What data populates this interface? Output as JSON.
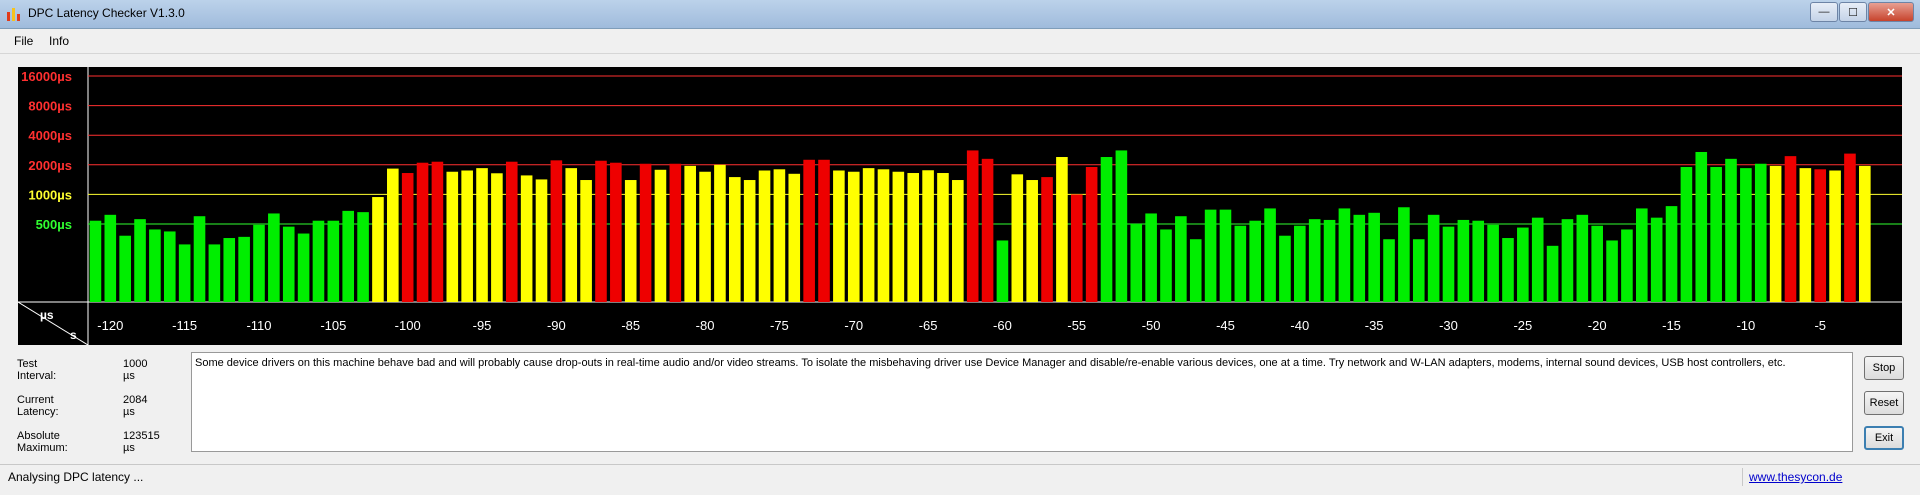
{
  "window": {
    "title": "DPC Latency Checker V1.3.0",
    "controls": [
      "minimize",
      "maximize",
      "close"
    ]
  },
  "menu": {
    "items": [
      {
        "label": "File"
      },
      {
        "label": "Info"
      }
    ]
  },
  "chart_data": {
    "type": "bar",
    "title": "",
    "y_scale": "log",
    "y_units_label": "µs",
    "x_units_label": "s",
    "y_gridlines": [
      {
        "label": "16000µs",
        "value": 16000,
        "color": "#ff3030"
      },
      {
        "label": "8000µs",
        "value": 8000,
        "color": "#ff3030"
      },
      {
        "label": "4000µs",
        "value": 4000,
        "color": "#ff3030"
      },
      {
        "label": "2000µs",
        "value": 2000,
        "color": "#ff3030"
      },
      {
        "label": "1000µs",
        "value": 1000,
        "color": "#ffff30"
      },
      {
        "label": "500µs",
        "value": 500,
        "color": "#30ff30"
      }
    ],
    "x_ticks": [
      -120,
      -115,
      -110,
      -105,
      -100,
      -95,
      -90,
      -85,
      -80,
      -75,
      -70,
      -65,
      -60,
      -55,
      -50,
      -45,
      -40,
      -35,
      -30,
      -25,
      -20,
      -15,
      -10,
      -5
    ],
    "x_range": [
      -121,
      1
    ],
    "colors": {
      "green": "#00ee00",
      "yellow": "#ffff00",
      "red": "#ee0000"
    },
    "series": [
      {
        "x_start": -121,
        "x_step": 1,
        "levels": "GGGGGGGGGGGGGGGGGGGYYRRRYYYYRYYRYYRRYRYRYYYYYYYYRRYYYYYYYYYRRGYYRYRRGGGGGGGGGGGGGGGGGGGGGGGGGGGGGGGGGGGGGGGGGGGGGYRYRYRYRYYRY",
        "values": [
          540,
          620,
          380,
          560,
          440,
          420,
          310,
          600,
          310,
          360,
          370,
          490,
          640,
          470,
          400,
          540,
          540,
          680,
          660,
          940,
          1830,
          1650,
          2100,
          2150,
          1700,
          1750,
          1850,
          1640,
          2150,
          1560,
          1420,
          2220,
          1850,
          1400,
          2200,
          2100,
          1400,
          2050,
          1780,
          2050,
          1950,
          1700,
          2000,
          1500,
          1400,
          1750,
          1800,
          1620,
          2250,
          2250,
          1750,
          1700,
          1850,
          1800,
          1700,
          1650,
          1760,
          1650,
          1400,
          2800,
          2300,
          340,
          1600,
          1400,
          1500,
          2400,
          1000,
          1900,
          2400,
          2800,
          500,
          640,
          440,
          600,
          350,
          700,
          700,
          480,
          540,
          720,
          380,
          480,
          560,
          550,
          720,
          620,
          650,
          350,
          740,
          350,
          620,
          470,
          550,
          540,
          490,
          360,
          460,
          580,
          300,
          560,
          620,
          480,
          340,
          440,
          720,
          580,
          760,
          1900,
          2700,
          1900,
          2300,
          1850,
          2050,
          1950,
          2450,
          1850,
          1800,
          1750,
          2600,
          1950
        ]
      }
    ]
  },
  "info": {
    "test_interval": {
      "label": "Test Interval:",
      "value": "1000 µs"
    },
    "current_latency": {
      "label": "Current Latency:",
      "value": "2084 µs"
    },
    "absolute_maximum": {
      "label": "Absolute Maximum:",
      "value": "123515 µs"
    }
  },
  "message": "Some device drivers on this machine behave bad and will probably cause drop-outs in real-time audio and/or video streams. To isolate the misbehaving driver use Device Manager and disable/re-enable various devices, one at a time. Try network and W-LAN adapters, modems, internal sound devices, USB host controllers, etc.",
  "buttons": {
    "stop": "Stop",
    "reset": "Reset",
    "exit": "Exit"
  },
  "status": {
    "text": "Analysing DPC latency ...",
    "link": "www.thesycon.de"
  }
}
